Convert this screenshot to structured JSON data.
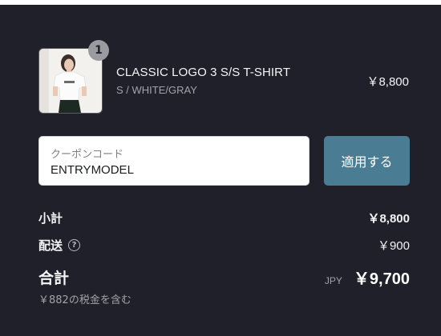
{
  "product": {
    "quantity": "1",
    "name": "CLASSIC LOGO 3 S/S T-SHIRT",
    "variant": "S / WHITE/GRAY",
    "price": "￥8,800",
    "image_icon": "tshirt-model-photo"
  },
  "coupon": {
    "label": "クーポンコード",
    "value": "ENTRYMODEL",
    "apply_label": "適用する"
  },
  "summary": {
    "subtotal_label": "小計",
    "subtotal_value": "￥8,800",
    "shipping_label": "配送",
    "shipping_help_icon": "question-circle-icon",
    "shipping_value": "￥900",
    "total_label": "合計",
    "tax_note": "￥882の税金を含む",
    "currency": "JPY",
    "total_value": "￥9,700"
  },
  "colors": {
    "background": "#1f2029",
    "apply_button": "#4a7d94",
    "badge": "#9a9ba1"
  }
}
